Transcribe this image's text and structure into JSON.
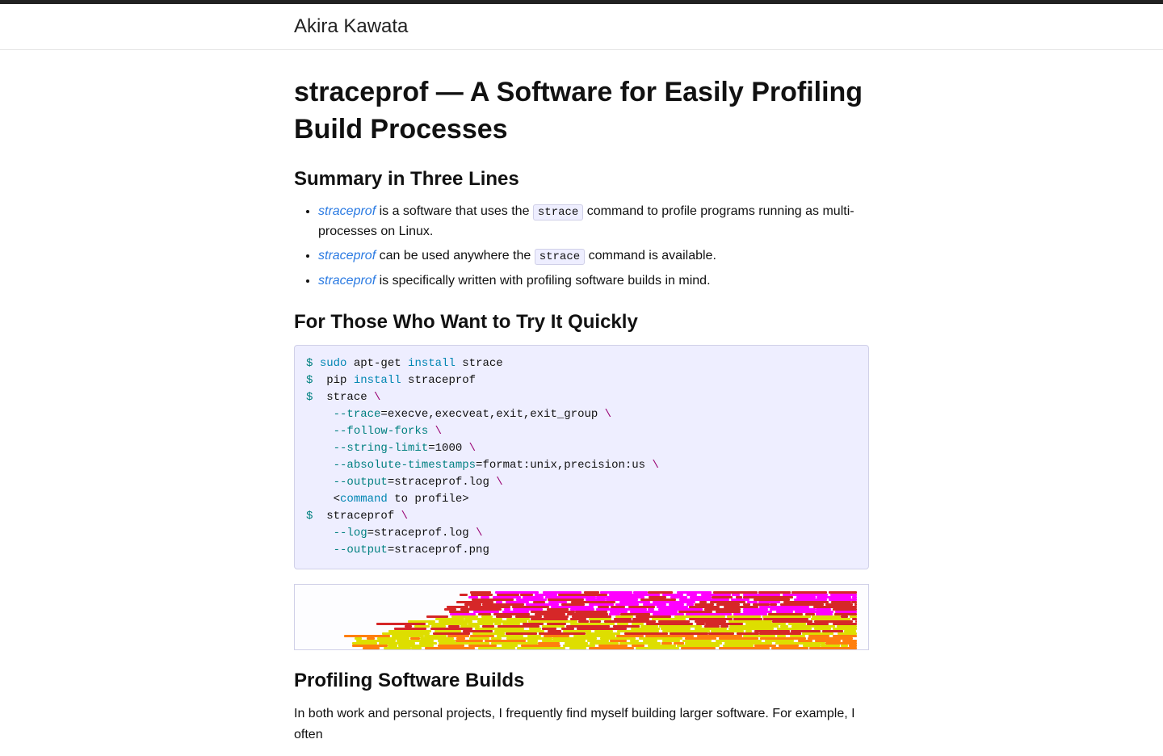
{
  "site": {
    "title": "Akira Kawata"
  },
  "page": {
    "title": "straceprof — A Software for Easily Profiling Build Processes"
  },
  "sections": {
    "summary_heading": "Summary in Three Lines",
    "quick_heading": "For Those Who Want to Try It Quickly",
    "profiling_heading": "Profiling Software Builds"
  },
  "summary": {
    "li1": {
      "link": "straceprof",
      "t1": " is a software that uses the ",
      "code": "strace",
      "t2": " command to profile programs running as multi-processes on Linux."
    },
    "li2": {
      "link": "straceprof",
      "t1": " can be used anywhere the ",
      "code": "strace",
      "t2": " command is available."
    },
    "li3": {
      "link": "straceprof",
      "t1": " is specifically written with profiling software builds in mind."
    }
  },
  "code": {
    "l1": {
      "prompt": "$ ",
      "sudo": "sudo",
      "sp1": " apt-get ",
      "install": "install",
      "rest": " strace"
    },
    "l2": {
      "prompt": "$ ",
      "pip": " pip ",
      "install": "install",
      "rest": " straceprof"
    },
    "l3": {
      "prompt": "$ ",
      "cmd": " strace ",
      "bs": "\\"
    },
    "l4": {
      "indent": "    ",
      "flag": "--trace",
      "eq": "=",
      "val": "execve,execveat,exit,exit_group ",
      "bs": "\\"
    },
    "l5": {
      "indent": "    ",
      "flag": "--follow-forks",
      "sp": " ",
      "bs": "\\"
    },
    "l6": {
      "indent": "    ",
      "flag": "--string-limit",
      "eq": "=",
      "val": "1000 ",
      "bs": "\\"
    },
    "l7": {
      "indent": "    ",
      "flag": "--absolute-timestamps",
      "eq": "=",
      "val": "format:unix,precision:us ",
      "bs": "\\"
    },
    "l8": {
      "indent": "    ",
      "flag": "--output",
      "eq": "=",
      "val": "straceprof.log ",
      "bs": "\\"
    },
    "l9": {
      "indent": "    <",
      "cmd": "command",
      "rest": " to profile>"
    },
    "l10": {
      "prompt": "$ ",
      "cmd": " straceprof ",
      "bs": "\\"
    },
    "l11": {
      "indent": "    ",
      "flag": "--log",
      "eq": "=",
      "val": "straceprof.log ",
      "bs": "\\"
    },
    "l12": {
      "indent": "    ",
      "flag": "--output",
      "eq": "=",
      "val": "straceprof.png"
    }
  },
  "body": {
    "p1": "In both work and personal projects, I frequently find myself building larger software. For example, I often"
  }
}
